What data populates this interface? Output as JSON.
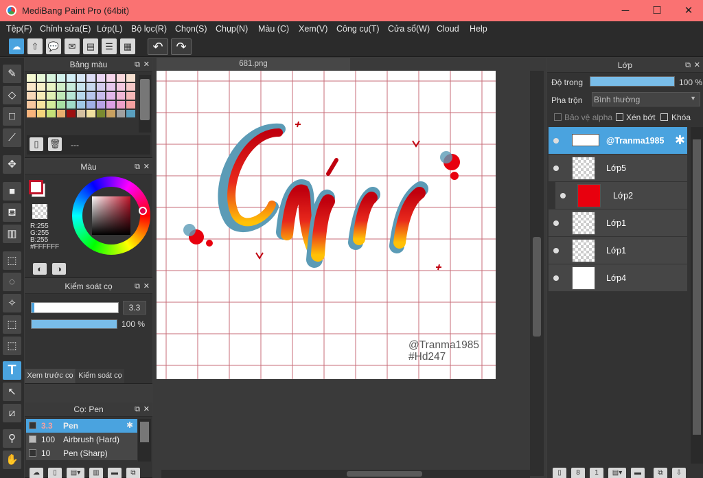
{
  "window": {
    "title": "MediBang Paint Pro (64bit)",
    "minimize": "─",
    "maximize": "☐",
    "close": "✕"
  },
  "menu": [
    "Tệp(F)",
    "Chỉnh sửa(E)",
    "Lớp(L)",
    "Bộ lọc(R)",
    "Chọn(S)",
    "Chụp(N)",
    "Màu (C)",
    "Xem(V)",
    "Công cụ(T)",
    "Cửa sổ(W)",
    "Cloud",
    "Help"
  ],
  "panels": {
    "swatch": {
      "title": "Bảng màu",
      "name": "---"
    },
    "color": {
      "title": "Màu",
      "r": "R:255",
      "g": "G:255",
      "b": "B:255",
      "hex": "#FFFFFF"
    },
    "brush_control": {
      "title": "Kiểm soát cọ",
      "size": "3.3",
      "opacity": "100 %",
      "opacity_value": 1.0
    },
    "tabs": {
      "preview": "Xem trước cọ",
      "control": "Kiểm soát cọ"
    },
    "brush_list": {
      "title": "Cọ: Pen",
      "items": [
        {
          "size": "3.3",
          "name": "Pen"
        },
        {
          "size": "100",
          "name": "Airbrush (Hard)"
        },
        {
          "size": "10",
          "name": "Pen (Sharp)"
        }
      ]
    }
  },
  "document": {
    "tab": "681.png",
    "watermark_line1": "@Tranma1985",
    "watermark_line2": "#Hd247"
  },
  "layers_panel": {
    "title": "Lớp",
    "opacity_label": "Độ trong",
    "opacity": "100 %",
    "opacity_value": 1.0,
    "blend_label": "Pha trộn",
    "blend_value": "Bình thường",
    "protect_alpha": "Bảo vệ alpha",
    "clip": "Xén bớt",
    "lock": "Khóa",
    "layers": [
      {
        "name": "@Tranma1985",
        "selected": true
      },
      {
        "name": "Lớp5",
        "selected": false
      },
      {
        "name": "Lớp2",
        "selected": false
      },
      {
        "name": "Lớp1",
        "selected": false
      },
      {
        "name": "Lớp1",
        "selected": false
      },
      {
        "name": "Lớp4",
        "selected": false
      }
    ]
  },
  "colors": {
    "accent": "#4aa3df",
    "titlebar": "#fa7272",
    "grid": "#c0394a"
  }
}
